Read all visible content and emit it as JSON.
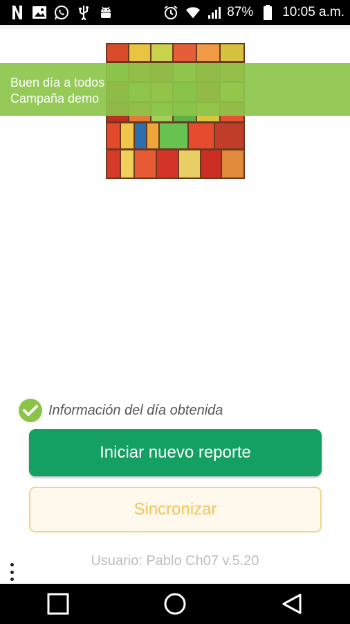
{
  "status_bar": {
    "left_icons": [
      "netflix-icon",
      "image-icon",
      "whatsapp-icon",
      "usb-icon",
      "android-debug-icon"
    ],
    "right_icons": [
      "alarm-icon",
      "wifi-icon",
      "signal-icon",
      "battery-icon"
    ],
    "battery_percent": "87%",
    "time": "10:05 a.m."
  },
  "banner": {
    "greeting": "Buen día a todos",
    "campaign": "Campaña demo",
    "background_color": "#8cc44a"
  },
  "status": {
    "message": "Información del día obtenida",
    "icon": "check-circle-icon",
    "icon_color": "#8cc44a"
  },
  "actions": {
    "primary_label": "Iniciar nuevo reporte",
    "primary_color": "#149f63",
    "secondary_label": "Sincronizar",
    "secondary_color": "#f4c357"
  },
  "footer": {
    "user_line": "Usuario: Pablo Ch07 v.5.20"
  },
  "nav_bar": {
    "buttons": [
      "recents-square-icon",
      "home-circle-icon",
      "back-triangle-icon"
    ]
  }
}
